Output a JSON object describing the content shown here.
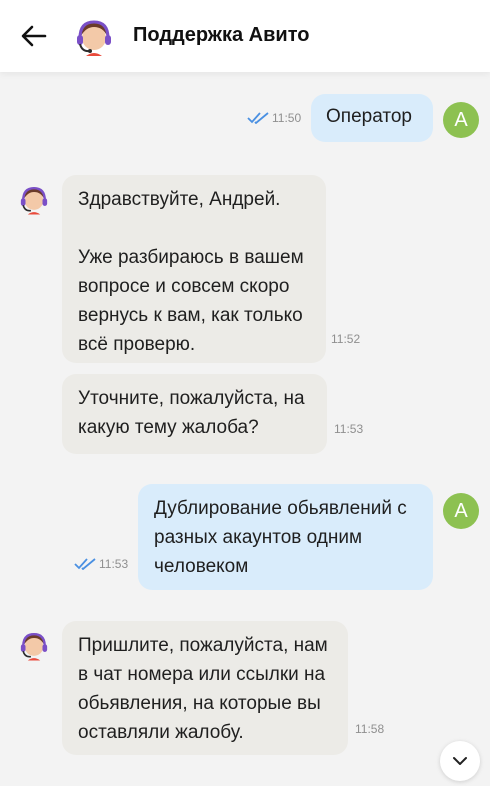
{
  "header": {
    "title": "Поддержка Авито"
  },
  "messages": [
    {
      "sender": "user",
      "text": "Оператор",
      "time": "11:50",
      "avatar": "А"
    },
    {
      "sender": "support",
      "text": "Здравствуйте, Андрей.\n\nУже разбираюсь в вашем\nвопросе и совсем скоро\nвернусь к вам, как только\nвсё проверю.",
      "time": "11:52"
    },
    {
      "sender": "support",
      "text": "Уточните, пожалуйста, на\nкакую тему жалоба?",
      "time": "11:53"
    },
    {
      "sender": "user",
      "text": "Дублирование обьявлений с\nразных акаунтов одним\nчеловеком",
      "time": "11:53",
      "avatar": "А"
    },
    {
      "sender": "support",
      "text": "Пришлите, пожалуйста, нам\nв чат номера или ссылки на\nобьявления, на которые вы\nоставляли жалобу.",
      "time": "11:58"
    }
  ],
  "colors": {
    "user_bubble": "#d9ecfb",
    "support_bubble": "#ecebe7",
    "user_avatar": "#8dc151",
    "read_ticks": "#4a90e2"
  },
  "icons": {
    "back": "arrow-left-icon",
    "scroll": "chevron-down-icon",
    "read": "double-check-icon"
  }
}
